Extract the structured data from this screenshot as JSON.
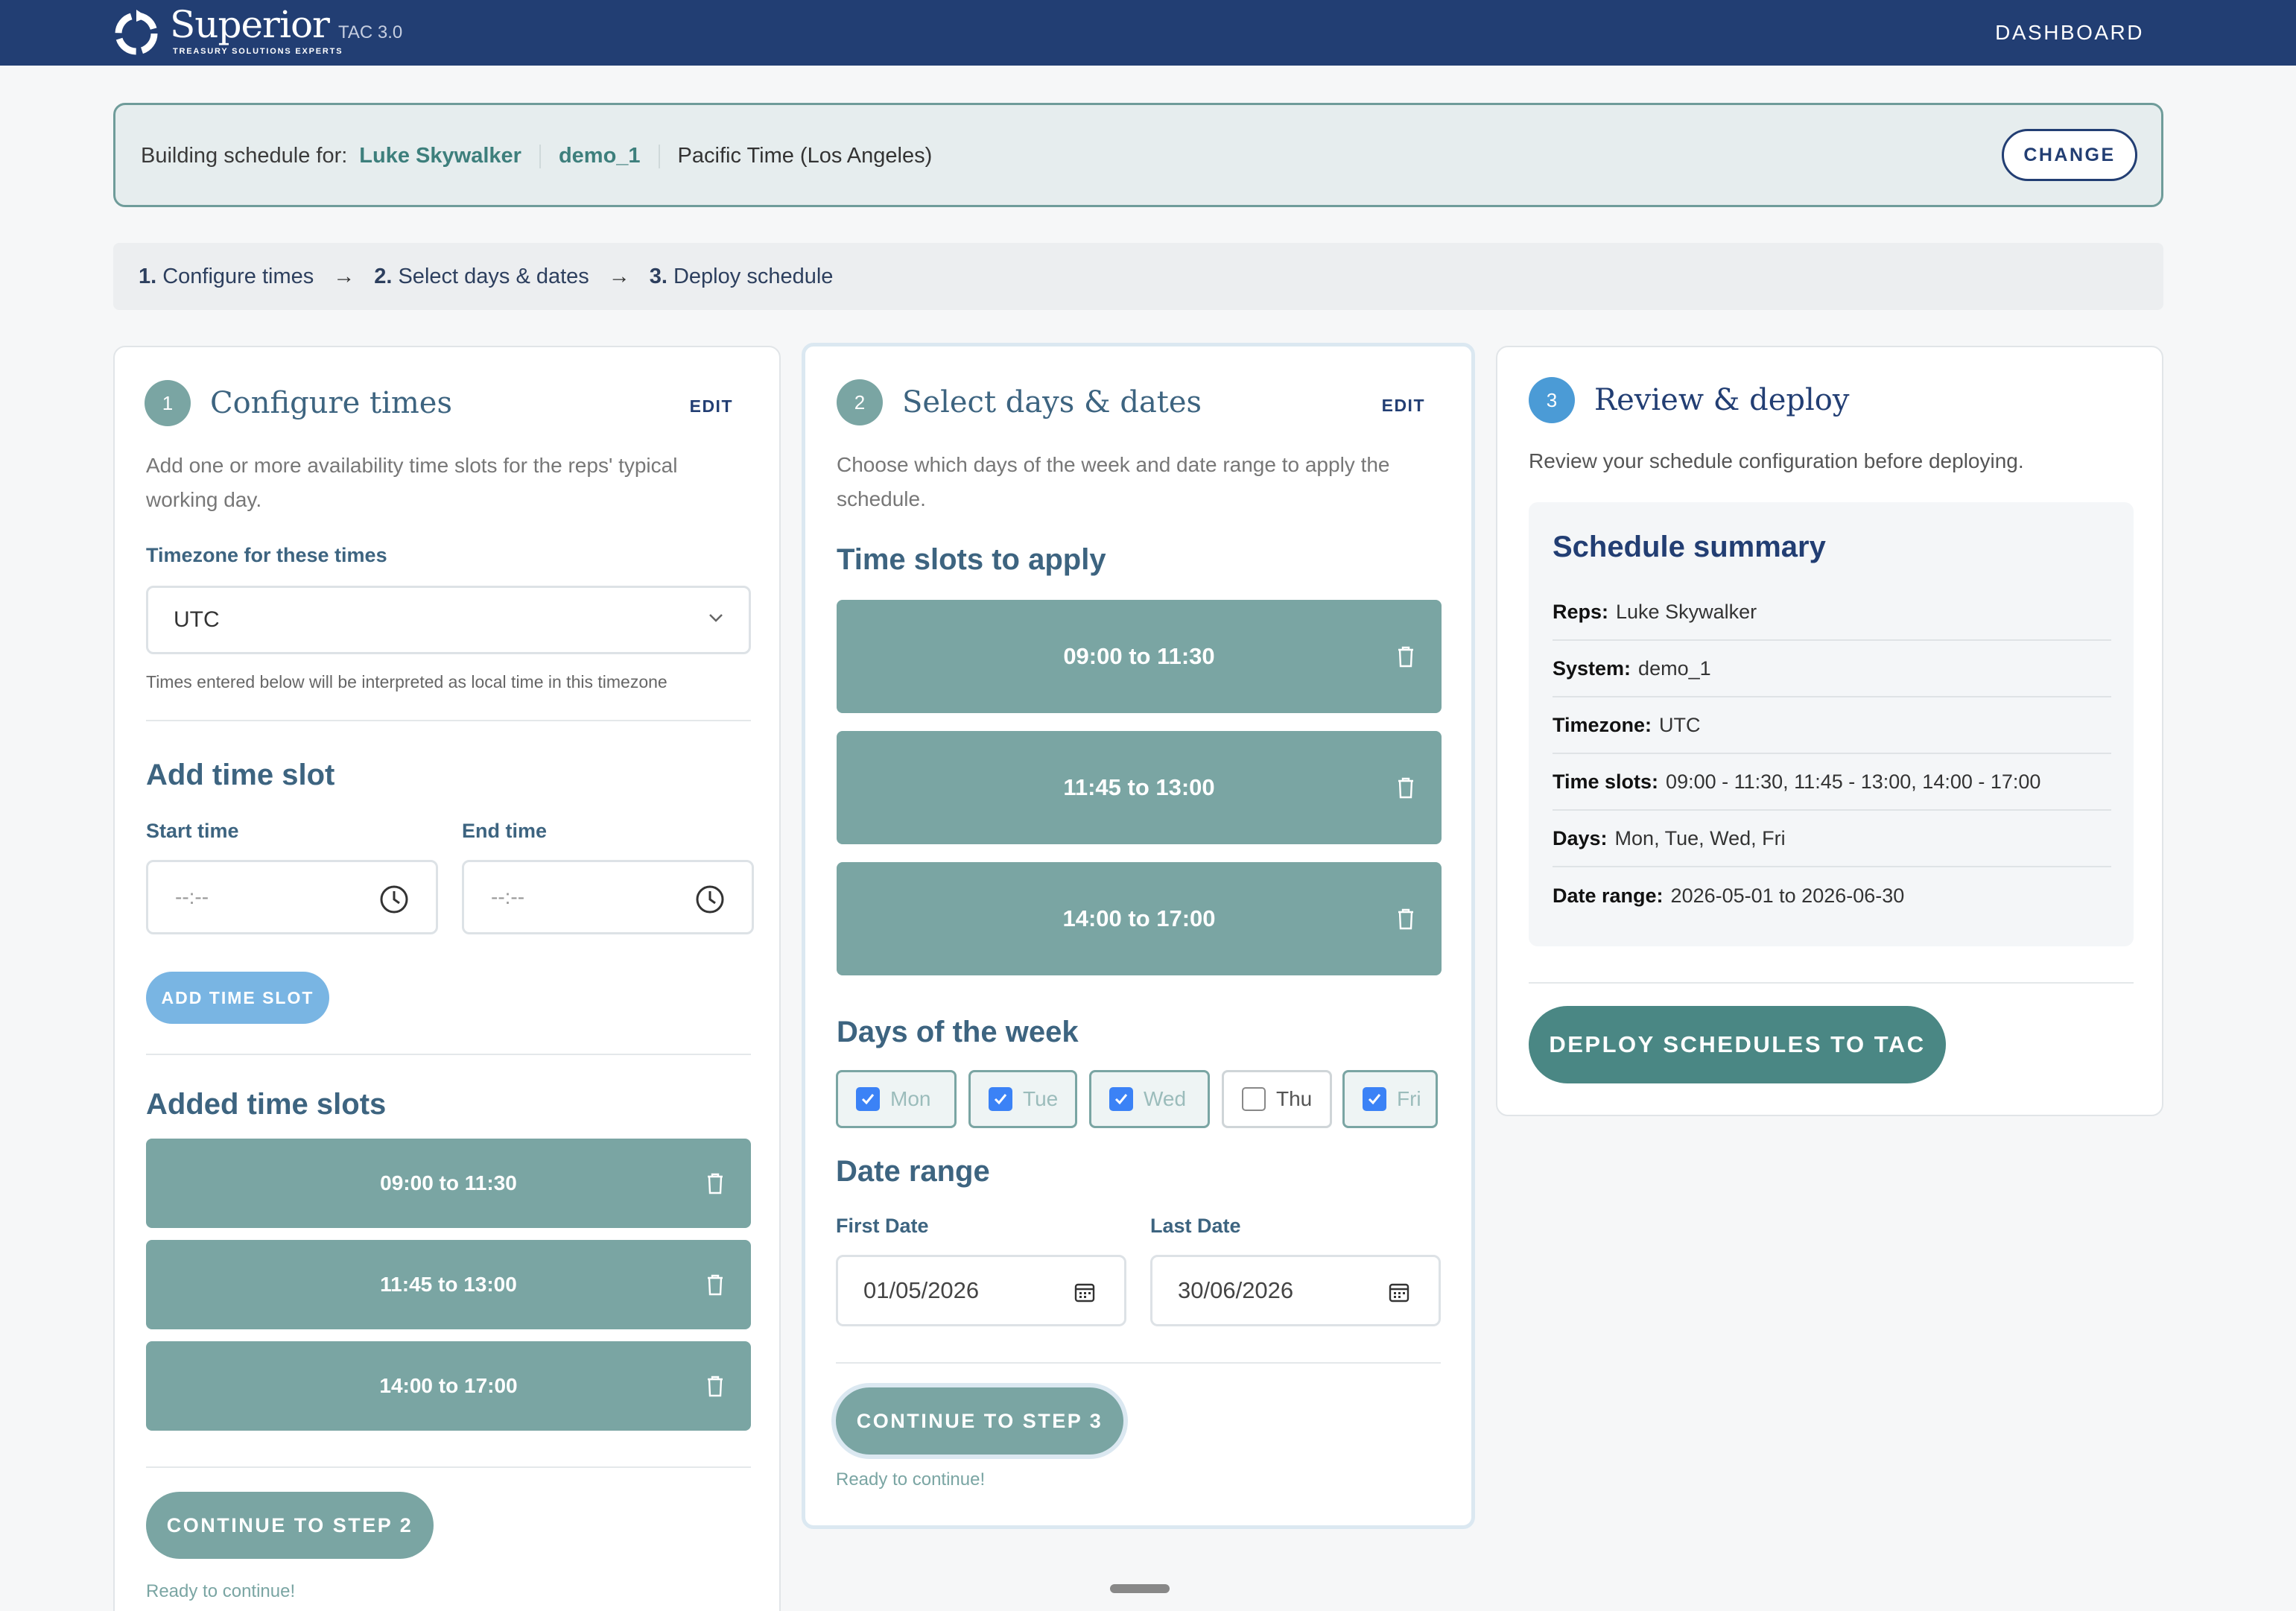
{
  "header": {
    "brand_name": "Superior",
    "brand_tag": "TREASURY SOLUTIONS EXPERTS",
    "version": "TAC 3.0",
    "nav_dashboard": "DASHBOARD"
  },
  "context": {
    "prefix": "Building schedule for:",
    "rep": "Luke Skywalker",
    "system": "demo_1",
    "timezone": "Pacific Time (Los Angeles)",
    "change_label": "CHANGE"
  },
  "steps": [
    {
      "num": "1.",
      "label": "Configure times"
    },
    {
      "num": "2.",
      "label": "Select days & dates"
    },
    {
      "num": "3.",
      "label": "Deploy schedule"
    }
  ],
  "step_arrow": "→",
  "configure": {
    "num": "1",
    "title": "Configure times",
    "edit": "EDIT",
    "description": "Add one or more availability time slots for the reps' typical working day.",
    "tz_label": "Timezone for these times",
    "tz_value": "UTC",
    "tz_hint": "Times entered below will be interpreted as local time in this timezone",
    "add_heading": "Add time slot",
    "start_label": "Start time",
    "end_label": "End time",
    "start_placeholder": "--:--",
    "end_placeholder": "--:--",
    "add_button": "ADD TIME SLOT",
    "added_heading": "Added time slots",
    "slots": [
      "09:00 to 11:30",
      "11:45 to 13:00",
      "14:00 to 17:00"
    ],
    "continue_button": "CONTINUE TO STEP 2",
    "ready": "Ready to continue!"
  },
  "select": {
    "num": "2",
    "title": "Select days & dates",
    "edit": "EDIT",
    "description": "Choose which days of the week and date range to apply the schedule.",
    "slots_heading": "Time slots to apply",
    "slots": [
      "09:00 to 11:30",
      "11:45 to 13:00",
      "14:00 to 17:00"
    ],
    "days_heading": "Days of the week",
    "days": [
      {
        "label": "Mon",
        "checked": true
      },
      {
        "label": "Tue",
        "checked": true
      },
      {
        "label": "Wed",
        "checked": true
      },
      {
        "label": "Thu",
        "checked": false
      },
      {
        "label": "Fri",
        "checked": true
      }
    ],
    "range_heading": "Date range",
    "first_label": "First Date",
    "last_label": "Last Date",
    "first_value": "01/05/2026",
    "last_value": "30/06/2026",
    "continue_button": "CONTINUE TO STEP 3",
    "ready": "Ready to continue!"
  },
  "review": {
    "num": "3",
    "title": "Review & deploy",
    "description": "Review your schedule configuration before deploying.",
    "summary_title": "Schedule summary",
    "rows": [
      {
        "key": "Reps:",
        "value": "Luke Skywalker"
      },
      {
        "key": "System:",
        "value": "demo_1"
      },
      {
        "key": "Timezone:",
        "value": "UTC"
      },
      {
        "key": "Time slots:",
        "value": "09:00 - 11:30, 11:45 - 13:00, 14:00 - 17:00"
      },
      {
        "key": "Days:",
        "value": "Mon, Tue, Wed, Fri"
      },
      {
        "key": "Date range:",
        "value": "2026-05-01 to 2026-06-30"
      }
    ],
    "deploy_button": "DEPLOY SCHEDULES TO TAC"
  },
  "colors": {
    "nav": "#223e73",
    "teal": "#7aa5a3",
    "teal_dark": "#4a8784",
    "blue": "#4b9bd6",
    "checkbox": "#3b82f6"
  }
}
